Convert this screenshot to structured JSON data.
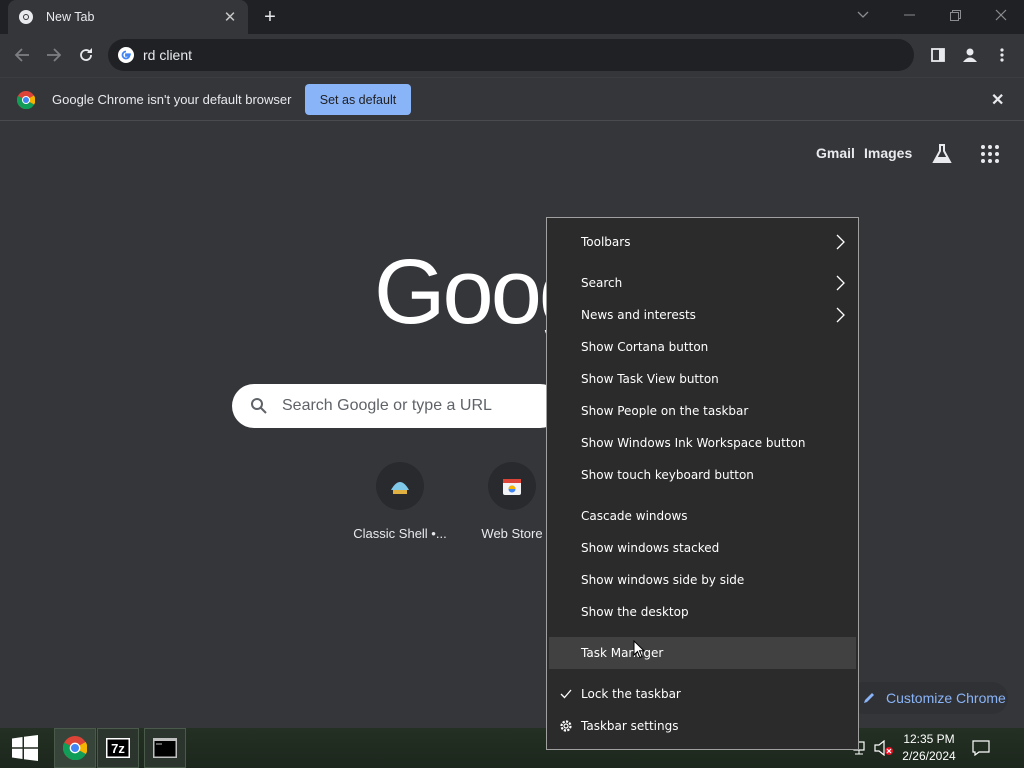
{
  "browser": {
    "tab": {
      "title": "New Tab"
    },
    "address_bar": {
      "value": "rd client"
    },
    "infobar": {
      "message": "Google Chrome isn't your default browser",
      "button": "Set as default"
    }
  },
  "ntp": {
    "links": {
      "gmail": "Gmail",
      "images": "Images"
    },
    "logo_text": "Goog",
    "search_placeholder": "Search Google or type a URL",
    "shortcuts": [
      {
        "label": "Classic Shell •..."
      },
      {
        "label": "Web Store"
      }
    ],
    "customize": "Customize Chrome"
  },
  "context_menu": {
    "items": [
      {
        "label": "Toolbars",
        "submenu": true
      },
      {
        "label": "Search",
        "submenu": true
      },
      {
        "label": "News and interests",
        "submenu": true
      },
      {
        "label": "Show Cortana button"
      },
      {
        "label": "Show Task View button"
      },
      {
        "label": "Show People on the taskbar"
      },
      {
        "label": "Show Windows Ink Workspace button"
      },
      {
        "label": "Show touch keyboard button"
      },
      {
        "label": "Cascade windows"
      },
      {
        "label": "Show windows stacked"
      },
      {
        "label": "Show windows side by side"
      },
      {
        "label": "Show the desktop"
      },
      {
        "label": "Task Manager",
        "highlighted": true
      },
      {
        "label": "Lock the taskbar",
        "checked": true
      },
      {
        "label": "Taskbar settings",
        "icon": "gear-icon"
      }
    ]
  },
  "taskbar": {
    "apps": [
      "chrome-icon",
      "7zip-icon",
      "console-icon"
    ],
    "clock": {
      "time": "12:35 PM",
      "date": "2/26/2024"
    }
  },
  "colors": {
    "accent_blue": "#8ab4f8",
    "menu_bg": "#2b2b2b",
    "taskbar_bg": "#1f2a1f"
  }
}
